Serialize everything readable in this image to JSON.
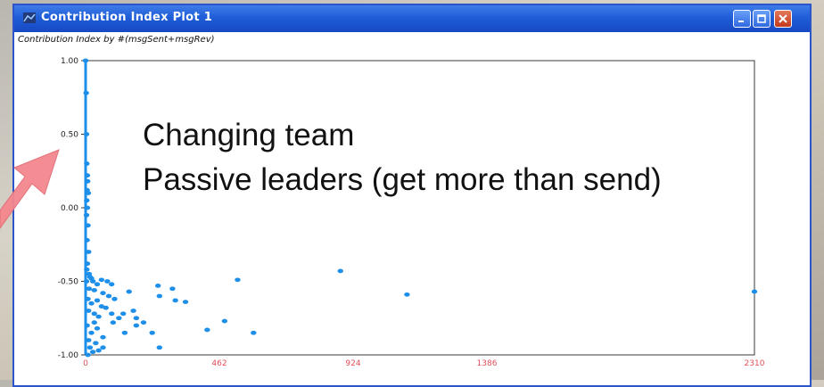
{
  "window": {
    "title": "Contribution Index Plot 1",
    "subtitle": "Contribution Index by #(msgSent+msgRev)",
    "colors": {
      "titlebar": "#1f5ed8",
      "close_button": "#c2391f"
    }
  },
  "annotation": {
    "line1": "Changing team",
    "line2": "Passive leaders (get more than send)"
  },
  "chart_data": {
    "type": "scatter",
    "title": "Contribution Index by #(msgSent+msgRev)",
    "xlabel": "",
    "ylabel": "",
    "xlim": [
      0,
      2310
    ],
    "ylim": [
      -1.0,
      1.0
    ],
    "x_ticks": [
      0,
      462,
      924,
      1386,
      2310
    ],
    "x_tick_labels": [
      "0",
      "462",
      "924",
      "1386",
      "2310"
    ],
    "y_ticks": [
      1.0,
      0.5,
      0.0,
      -0.5,
      -1.0
    ],
    "y_tick_labels": [
      "1.00",
      "0.50",
      "0.00",
      "-0.50",
      "-1.00"
    ],
    "grid": false,
    "point_color": "#1e8fe8",
    "tick_label_color_x": "#e0505a",
    "series": [
      {
        "values": [
          [
            0,
            1.0
          ],
          [
            2,
            0.78
          ],
          [
            3,
            0.5
          ],
          [
            4,
            0.3
          ],
          [
            6,
            0.22
          ],
          [
            7,
            0.18
          ],
          [
            5,
            0.12
          ],
          [
            9,
            0.1
          ],
          [
            4,
            0.05
          ],
          [
            6,
            0.0
          ],
          [
            3,
            -0.05
          ],
          [
            8,
            -0.12
          ],
          [
            5,
            -0.22
          ],
          [
            10,
            -0.3
          ],
          [
            6,
            -0.38
          ],
          [
            4,
            -0.42
          ],
          [
            12,
            -0.45
          ],
          [
            15,
            -0.47
          ],
          [
            20,
            -0.48
          ],
          [
            3,
            -0.5
          ],
          [
            25,
            -0.5
          ],
          [
            40,
            -0.52
          ],
          [
            55,
            -0.49
          ],
          [
            75,
            -0.5
          ],
          [
            90,
            -0.52
          ],
          [
            12,
            -0.55
          ],
          [
            30,
            -0.56
          ],
          [
            60,
            -0.58
          ],
          [
            80,
            -0.6
          ],
          [
            8,
            -0.62
          ],
          [
            40,
            -0.63
          ],
          [
            100,
            -0.62
          ],
          [
            20,
            -0.65
          ],
          [
            55,
            -0.67
          ],
          [
            70,
            -0.68
          ],
          [
            10,
            -0.7
          ],
          [
            30,
            -0.72
          ],
          [
            45,
            -0.74
          ],
          [
            90,
            -0.72
          ],
          [
            130,
            -0.72
          ],
          [
            95,
            -0.78
          ],
          [
            115,
            -0.75
          ],
          [
            5,
            -0.8
          ],
          [
            30,
            -0.78
          ],
          [
            40,
            -0.82
          ],
          [
            20,
            -0.85
          ],
          [
            60,
            -0.88
          ],
          [
            10,
            -0.9
          ],
          [
            35,
            -0.92
          ],
          [
            15,
            -0.95
          ],
          [
            45,
            -0.97
          ],
          [
            25,
            -0.98
          ],
          [
            60,
            -0.95
          ],
          [
            8,
            -1.0
          ],
          [
            150,
            -0.57
          ],
          [
            165,
            -0.7
          ],
          [
            175,
            -0.8
          ],
          [
            135,
            -0.85
          ],
          [
            175,
            -0.75
          ],
          [
            200,
            -0.78
          ],
          [
            230,
            -0.85
          ],
          [
            250,
            -0.53
          ],
          [
            255,
            -0.6
          ],
          [
            300,
            -0.55
          ],
          [
            310,
            -0.63
          ],
          [
            345,
            -0.64
          ],
          [
            255,
            -0.95
          ],
          [
            420,
            -0.83
          ],
          [
            480,
            -0.77
          ],
          [
            525,
            -0.49
          ],
          [
            580,
            -0.85
          ],
          [
            880,
            -0.43
          ],
          [
            1110,
            -0.59
          ],
          [
            2310,
            -0.57
          ]
        ]
      }
    ]
  }
}
